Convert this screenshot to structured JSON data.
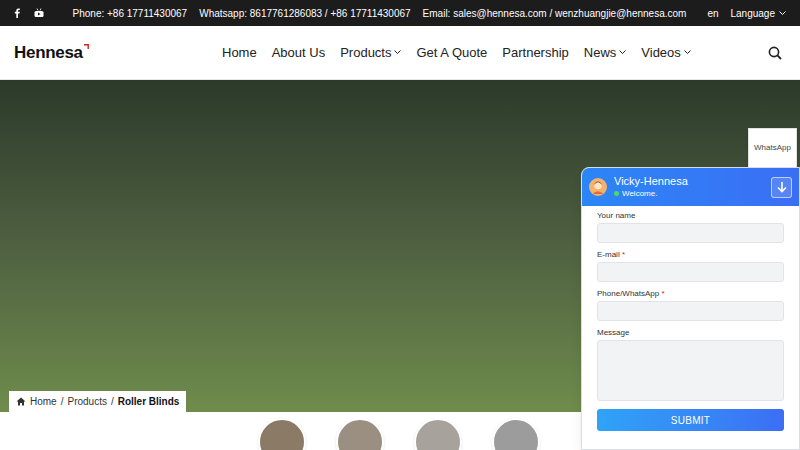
{
  "topbar": {
    "contacts": [
      "Phone: +86 17711430067",
      "Whatsapp: 8617761286083 / +86 17711430067",
      "Email: sales@hennesa.com / wenzhuangjie@hennesa.com"
    ],
    "language": {
      "code": "en",
      "label": "Language"
    }
  },
  "logo": "Hennesa",
  "nav": [
    {
      "label": "Home",
      "dropdown": false
    },
    {
      "label": "About Us",
      "dropdown": false
    },
    {
      "label": "Products",
      "dropdown": true
    },
    {
      "label": "Get A Quote",
      "dropdown": false
    },
    {
      "label": "Partnership",
      "dropdown": false
    },
    {
      "label": "News",
      "dropdown": true
    },
    {
      "label": "Videos",
      "dropdown": true
    }
  ],
  "breadcrumb": {
    "separator": "/",
    "items": [
      {
        "label": "Home",
        "current": false
      },
      {
        "label": "Products",
        "current": false
      },
      {
        "label": "Roller Blinds",
        "current": true
      }
    ]
  },
  "whatsapp_tab": "WhatsApp",
  "chat": {
    "agent": "Vicky-Hennesa",
    "status": "Welcome.",
    "online": true,
    "required_mark": "*",
    "fields": [
      {
        "label": "Your name",
        "required": false,
        "kind": "input"
      },
      {
        "label": "E-mail",
        "required": true,
        "kind": "input"
      },
      {
        "label": "Phone/WhatsApp",
        "required": true,
        "kind": "input"
      },
      {
        "label": "Message",
        "required": false,
        "kind": "textarea"
      }
    ],
    "submit": "SUBMIT"
  }
}
